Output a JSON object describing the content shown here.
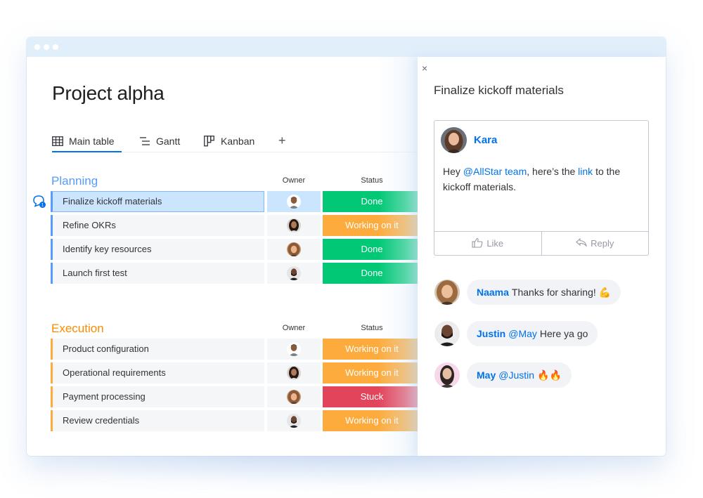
{
  "window": {
    "controls": [
      "dot",
      "dot",
      "dot"
    ]
  },
  "page": {
    "title": "Project alpha"
  },
  "tabs": [
    {
      "label": "Main table",
      "icon": "table-icon",
      "active": true
    },
    {
      "label": "Gantt",
      "icon": "gantt-icon",
      "active": false
    },
    {
      "label": "Kanban",
      "icon": "kanban-icon",
      "active": false
    },
    {
      "label": "+",
      "icon": "plus-icon",
      "active": false
    }
  ],
  "colors": {
    "accent": "#0073ea",
    "planning": "#579bfc",
    "execution": "#fdab3d",
    "done": "#00c875",
    "working": "#fdab3d",
    "stuck": "#e2445c"
  },
  "groups": [
    {
      "title": "Planning",
      "owner_header": "Owner",
      "status_header": "Status",
      "rows": [
        {
          "name": "Finalize kickoff materials",
          "owner": "man-short-hair",
          "status": "Done",
          "selected": true,
          "comments": 1
        },
        {
          "name": "Refine OKRs",
          "owner": "woman-dark-hair",
          "status": "Working on it"
        },
        {
          "name": "Identify key resources",
          "owner": "woman-curly-hair",
          "status": "Done"
        },
        {
          "name": "Launch first test",
          "owner": "man-beard",
          "status": "Done"
        }
      ]
    },
    {
      "title": "Execution",
      "owner_header": "Owner",
      "status_header": "Status",
      "rows": [
        {
          "name": "Product configuration",
          "owner": "man-short-hair",
          "status": "Working on it"
        },
        {
          "name": "Operational requirements",
          "owner": "woman-dark-hair",
          "status": "Working on it"
        },
        {
          "name": "Payment processing",
          "owner": "woman-curly-hair",
          "status": "Stuck"
        },
        {
          "name": "Review credentials",
          "owner": "man-beard",
          "status": "Working on it"
        }
      ]
    }
  ],
  "panel": {
    "close_label": "×",
    "title": "Finalize kickoff materials",
    "post": {
      "author": "Kara",
      "body_prefix": "Hey ",
      "mention": "@AllStar team",
      "body_mid": ", here’s the ",
      "link": "link",
      "body_suffix": " to the kickoff materials.",
      "like_label": "Like",
      "reply_label": "Reply"
    },
    "replies": [
      {
        "author": "Naama",
        "mention": "",
        "text": "Thanks for sharing! 💪"
      },
      {
        "author": "Justin",
        "mention": "@May",
        "text": "Here ya go"
      },
      {
        "author": "May",
        "mention": "@Justin",
        "text": "🔥🔥"
      }
    ]
  }
}
